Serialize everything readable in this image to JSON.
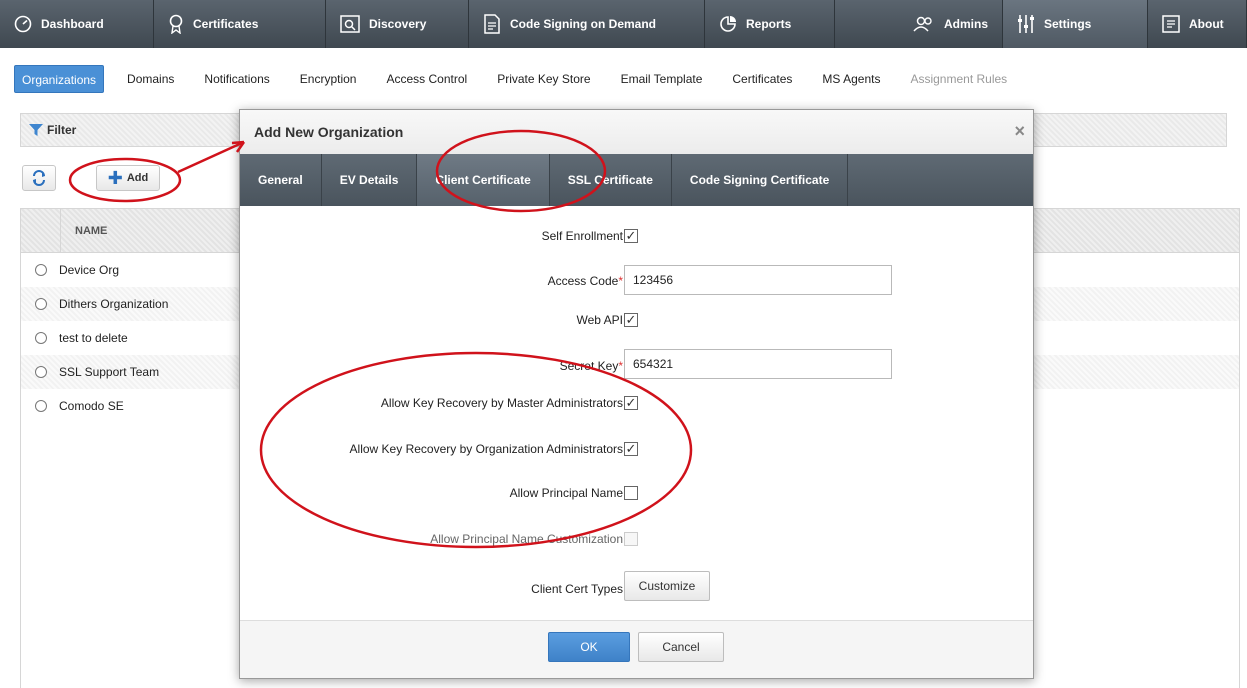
{
  "topnav": {
    "items": [
      {
        "label": "Dashboard",
        "icon": "dashboard-icon"
      },
      {
        "label": "Certificates",
        "icon": "certificate-icon"
      },
      {
        "label": "Discovery",
        "icon": "discovery-icon"
      },
      {
        "label": "Code Signing on Demand",
        "icon": "code-signing-icon"
      },
      {
        "label": "Reports",
        "icon": "reports-icon"
      },
      {
        "label": "Admins",
        "icon": "admins-icon"
      },
      {
        "label": "Settings",
        "icon": "settings-icon"
      },
      {
        "label": "About",
        "icon": "about-icon"
      }
    ],
    "active": "Settings"
  },
  "subtabs": [
    "Organizations",
    "Domains",
    "Notifications",
    "Encryption",
    "Access Control",
    "Private Key Store",
    "Email Template",
    "Certificates",
    "MS Agents",
    "Assignment Rules"
  ],
  "filter": {
    "label": "Filter"
  },
  "toolbar": {
    "add_label": "Add"
  },
  "list": {
    "column_name": "NAME",
    "rows": [
      "Device Org",
      "Dithers Organization",
      "test to delete",
      "SSL Support Team",
      "Comodo SE"
    ]
  },
  "modal": {
    "title": "Add New Organization",
    "close_glyph": "×",
    "tabs": [
      "General",
      "EV Details",
      "Client Certificate",
      "SSL Certificate",
      "Code Signing Certificate"
    ],
    "active_tab": "Client Certificate",
    "fields": {
      "self_enrollment": {
        "label": "Self Enrollment",
        "checked": true
      },
      "access_code": {
        "label": "Access Code",
        "value": "123456",
        "required": true
      },
      "web_api": {
        "label": "Web API",
        "checked": true
      },
      "secret_key": {
        "label": "Secret Key",
        "value": "654321",
        "required": true
      },
      "key_recovery_master": {
        "label": "Allow Key Recovery by Master Administrators",
        "checked": true
      },
      "key_recovery_org": {
        "label": "Allow Key Recovery by Organization Administrators",
        "checked": true
      },
      "principal_name": {
        "label": "Allow Principal Name",
        "checked": false
      },
      "principal_name_custom": {
        "label": "Allow Principal Name Customization",
        "checked": false,
        "disabled": true
      },
      "client_cert_types": {
        "label": "Client Cert Types",
        "button": "Customize"
      }
    },
    "required_mark": "*",
    "check_glyph": "✓",
    "ok_label": "OK",
    "cancel_label": "Cancel"
  },
  "colors": {
    "accent": "#4a90d6",
    "nav_bg": "#4a545d",
    "annotation": "#d0121b"
  }
}
